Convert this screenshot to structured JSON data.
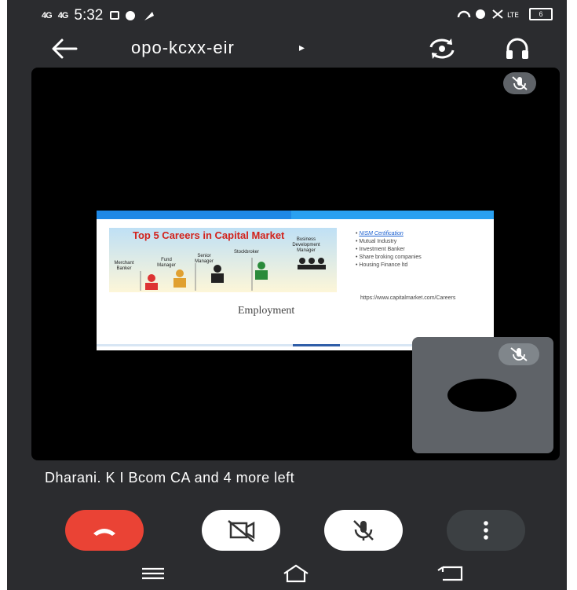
{
  "status_bar": {
    "signal_1": "4G",
    "signal_2": "4G",
    "time": "5:32",
    "battery": "6"
  },
  "header": {
    "meeting_code": "opo-kcxx-eir",
    "caret": "▸"
  },
  "slide": {
    "banner_title": "Top 5 Careers in Capital Market",
    "roles": [
      "Merchant Banker",
      "Fund Manager",
      "Senior Manager",
      "Stockbroker",
      "Business Development Manager"
    ],
    "list": [
      "NISM Certification",
      "Mutual Industry",
      "Investment Banker",
      "Share broking companies",
      "Housing Finance ltd"
    ],
    "url": "https://www.capitalmarket.com/Careers",
    "caption": "Employment"
  },
  "participants_note": "Dharani. K I Bcom CA and 4 more left",
  "controls": {
    "hangup": "end-call",
    "camera": "camera-off",
    "mic": "mic-off",
    "more": "more-options"
  },
  "colors": {
    "background": "#2b2c2f",
    "hangup": "#ea4335",
    "stage": "#000000",
    "tile": "#5f6368"
  }
}
